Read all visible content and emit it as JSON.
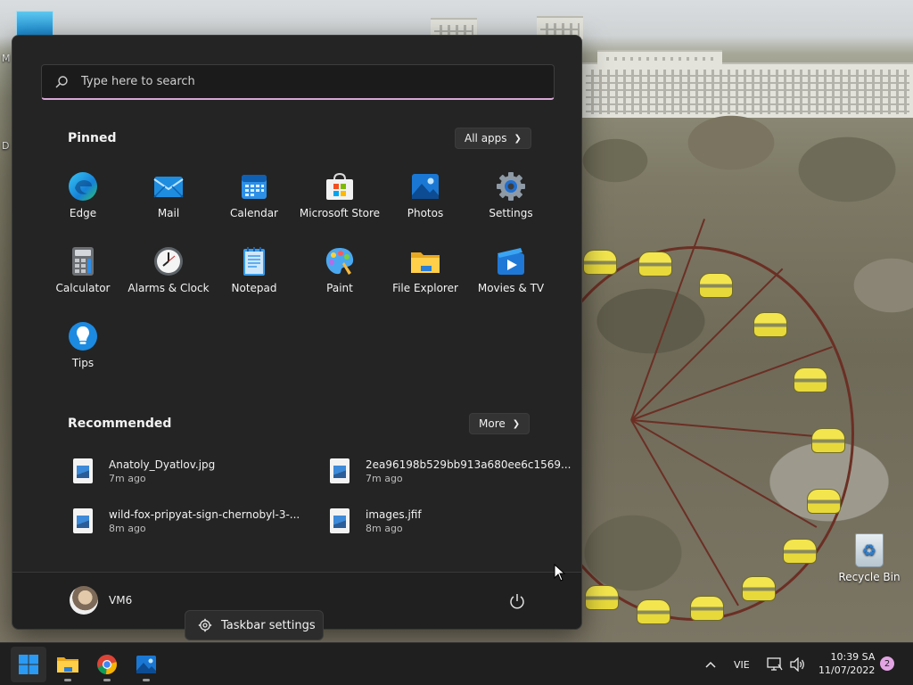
{
  "desktop": {
    "recycle_bin_label": "Recycle Bin",
    "partial_icon_labels": [
      "M",
      "D"
    ]
  },
  "start_menu": {
    "search_placeholder": "Type here to search",
    "pinned_title": "Pinned",
    "all_apps_label": "All apps",
    "pinned_apps": [
      {
        "label": "Edge",
        "icon": "edge-icon"
      },
      {
        "label": "Mail",
        "icon": "mail-icon"
      },
      {
        "label": "Calendar",
        "icon": "calendar-icon"
      },
      {
        "label": "Microsoft Store",
        "icon": "store-icon"
      },
      {
        "label": "Photos",
        "icon": "photos-icon"
      },
      {
        "label": "Settings",
        "icon": "settings-icon"
      },
      {
        "label": "Calculator",
        "icon": "calculator-icon"
      },
      {
        "label": "Alarms & Clock",
        "icon": "clock-icon"
      },
      {
        "label": "Notepad",
        "icon": "notepad-icon"
      },
      {
        "label": "Paint",
        "icon": "paint-icon"
      },
      {
        "label": "File Explorer",
        "icon": "folder-icon"
      },
      {
        "label": "Movies & TV",
        "icon": "movies-icon"
      },
      {
        "label": "Tips",
        "icon": "tips-icon"
      }
    ],
    "recommended_title": "Recommended",
    "more_label": "More",
    "recommended": [
      {
        "name": "Anatoly_Dyatlov.jpg",
        "time": "7m ago"
      },
      {
        "name": "2ea96198b529bb913a680ee6c1569...",
        "time": "7m ago"
      },
      {
        "name": "wild-fox-pripyat-sign-chernobyl-3-...",
        "time": "8m ago"
      },
      {
        "name": "images.jfif",
        "time": "8m ago"
      }
    ],
    "user_name": "VM6"
  },
  "taskbar_settings_label": "Taskbar settings",
  "taskbar": {
    "language": "VIE",
    "time": "10:39 SA",
    "date": "11/07/2022",
    "notification_count": "2"
  },
  "colors": {
    "start_bg": "#242424",
    "taskbar_bg": "#1f1f1f",
    "search_accent": "#d9a8d8",
    "windows_blue": "#2b9af3"
  }
}
